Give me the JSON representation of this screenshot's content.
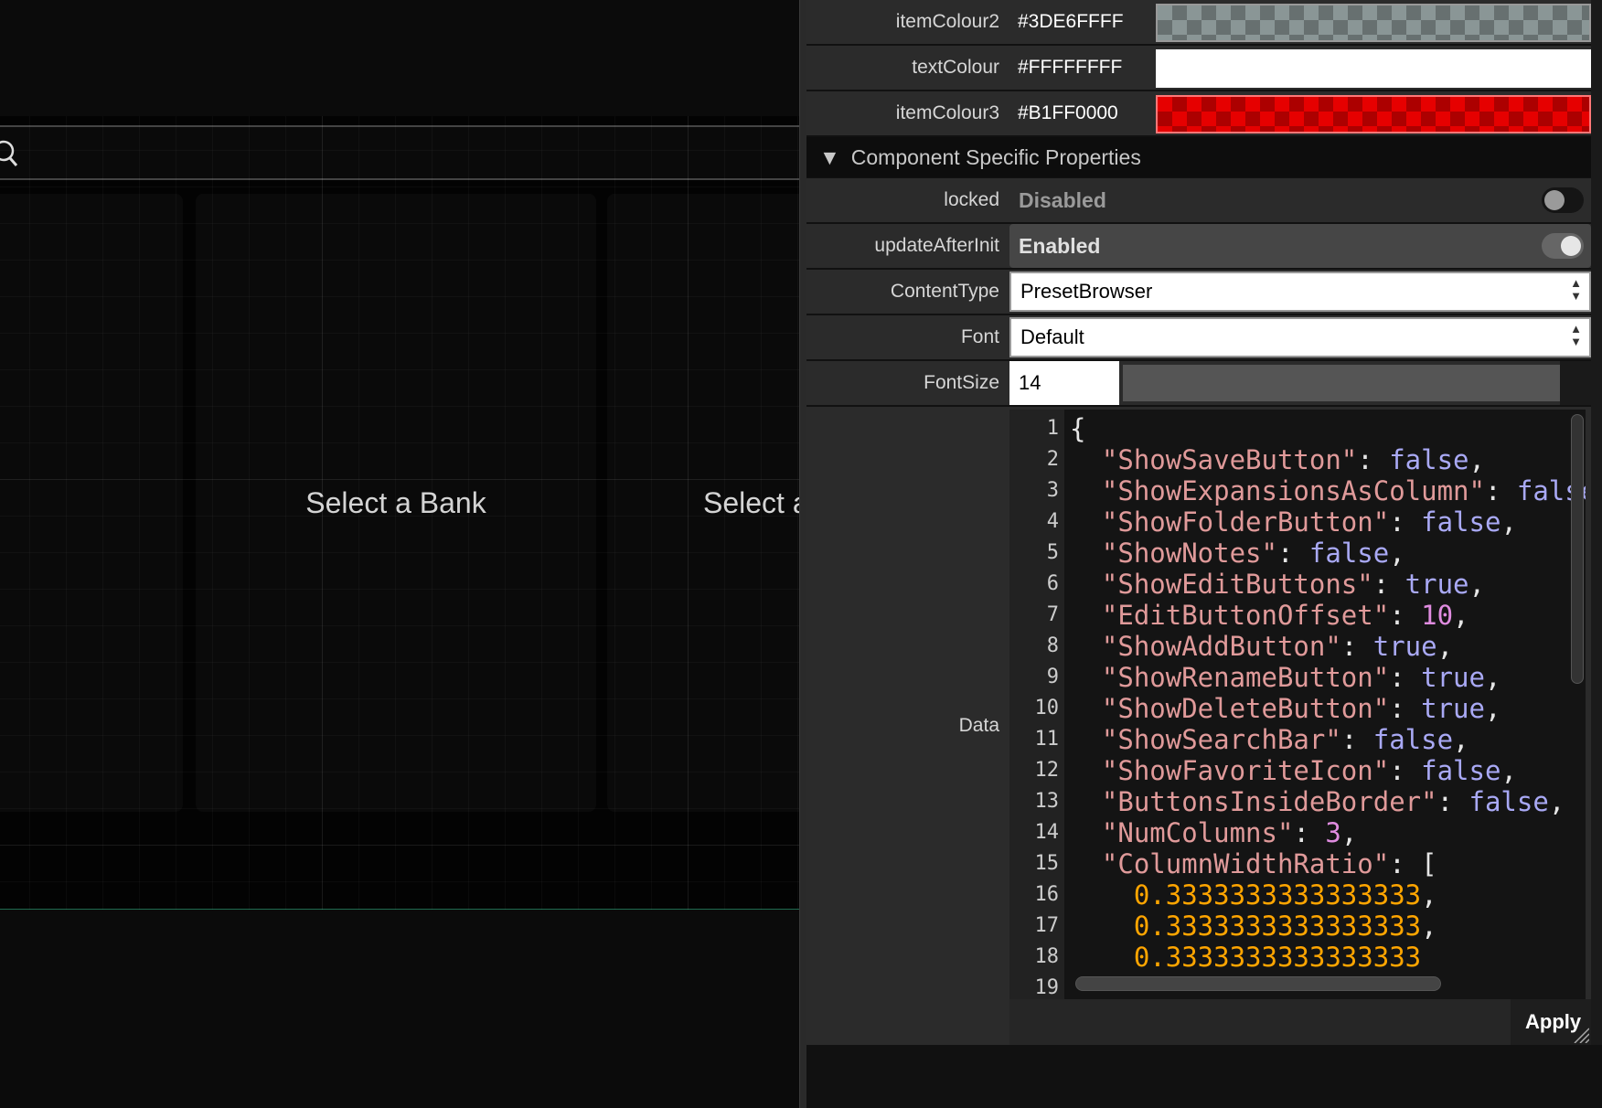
{
  "canvas": {
    "column_labels": [
      "Select a Bank",
      "Select a"
    ],
    "accent_line_color": "#1f6b4f"
  },
  "properties": {
    "colours": [
      {
        "name": "itemColour2",
        "value": "#3DE6FFFF",
        "swatch": "#8a9696"
      },
      {
        "name": "textColour",
        "value": "#FFFFFFFF",
        "swatch": "#ffffff"
      },
      {
        "name": "itemColour3",
        "value": "#B1FF0000",
        "swatch": "#e60000"
      }
    ],
    "section_title": "Component Specific Properties",
    "locked": {
      "label": "locked",
      "value": "Disabled",
      "on": false
    },
    "updateAfterInit": {
      "label": "updateAfterInit",
      "value": "Enabled",
      "on": true
    },
    "contentType": {
      "label": "ContentType",
      "value": "PresetBrowser"
    },
    "font": {
      "label": "Font",
      "value": "Default"
    },
    "fontSize": {
      "label": "FontSize",
      "value": "14"
    },
    "data": {
      "label": "Data",
      "colors": {
        "key": "#e09a9a",
        "bool": "#a9a9f5",
        "num": "#e08ce0",
        "float": "#ffa500",
        "punct": "#e6e6e6"
      },
      "lines": [
        [
          [
            "punct",
            "{"
          ]
        ],
        [
          [
            "key",
            "  \"ShowSaveButton\""
          ],
          [
            "punct",
            ": "
          ],
          [
            "bool",
            "false"
          ],
          [
            "punct",
            ","
          ]
        ],
        [
          [
            "key",
            "  \"ShowExpansionsAsColumn\""
          ],
          [
            "punct",
            ": "
          ],
          [
            "bool",
            "false,"
          ]
        ],
        [
          [
            "key",
            "  \"ShowFolderButton\""
          ],
          [
            "punct",
            ": "
          ],
          [
            "bool",
            "false"
          ],
          [
            "punct",
            ","
          ]
        ],
        [
          [
            "key",
            "  \"ShowNotes\""
          ],
          [
            "punct",
            ": "
          ],
          [
            "bool",
            "false"
          ],
          [
            "punct",
            ","
          ]
        ],
        [
          [
            "key",
            "  \"ShowEditButtons\""
          ],
          [
            "punct",
            ": "
          ],
          [
            "bool",
            "true"
          ],
          [
            "punct",
            ","
          ]
        ],
        [
          [
            "key",
            "  \"EditButtonOffset\""
          ],
          [
            "punct",
            ": "
          ],
          [
            "num",
            "10"
          ],
          [
            "punct",
            ","
          ]
        ],
        [
          [
            "key",
            "  \"ShowAddButton\""
          ],
          [
            "punct",
            ": "
          ],
          [
            "bool",
            "true"
          ],
          [
            "punct",
            ","
          ]
        ],
        [
          [
            "key",
            "  \"ShowRenameButton\""
          ],
          [
            "punct",
            ": "
          ],
          [
            "bool",
            "true"
          ],
          [
            "punct",
            ","
          ]
        ],
        [
          [
            "key",
            "  \"ShowDeleteButton\""
          ],
          [
            "punct",
            ": "
          ],
          [
            "bool",
            "true"
          ],
          [
            "punct",
            ","
          ]
        ],
        [
          [
            "key",
            "  \"ShowSearchBar\""
          ],
          [
            "punct",
            ": "
          ],
          [
            "bool",
            "false"
          ],
          [
            "punct",
            ","
          ]
        ],
        [
          [
            "key",
            "  \"ShowFavoriteIcon\""
          ],
          [
            "punct",
            ": "
          ],
          [
            "bool",
            "false"
          ],
          [
            "punct",
            ","
          ]
        ],
        [
          [
            "key",
            "  \"ButtonsInsideBorder\""
          ],
          [
            "punct",
            ": "
          ],
          [
            "bool",
            "false"
          ],
          [
            "punct",
            ","
          ]
        ],
        [
          [
            "key",
            "  \"NumColumns\""
          ],
          [
            "punct",
            ": "
          ],
          [
            "num",
            "3"
          ],
          [
            "punct",
            ","
          ]
        ],
        [
          [
            "key",
            "  \"ColumnWidthRatio\""
          ],
          [
            "punct",
            ": ["
          ]
        ],
        [
          [
            "float",
            "    0.3333333333333333"
          ],
          [
            "punct",
            ","
          ]
        ],
        [
          [
            "float",
            "    0.3333333333333333"
          ],
          [
            "punct",
            ","
          ]
        ],
        [
          [
            "float",
            "    0.3333333333333333"
          ]
        ],
        []
      ]
    },
    "apply_label": "Apply"
  }
}
